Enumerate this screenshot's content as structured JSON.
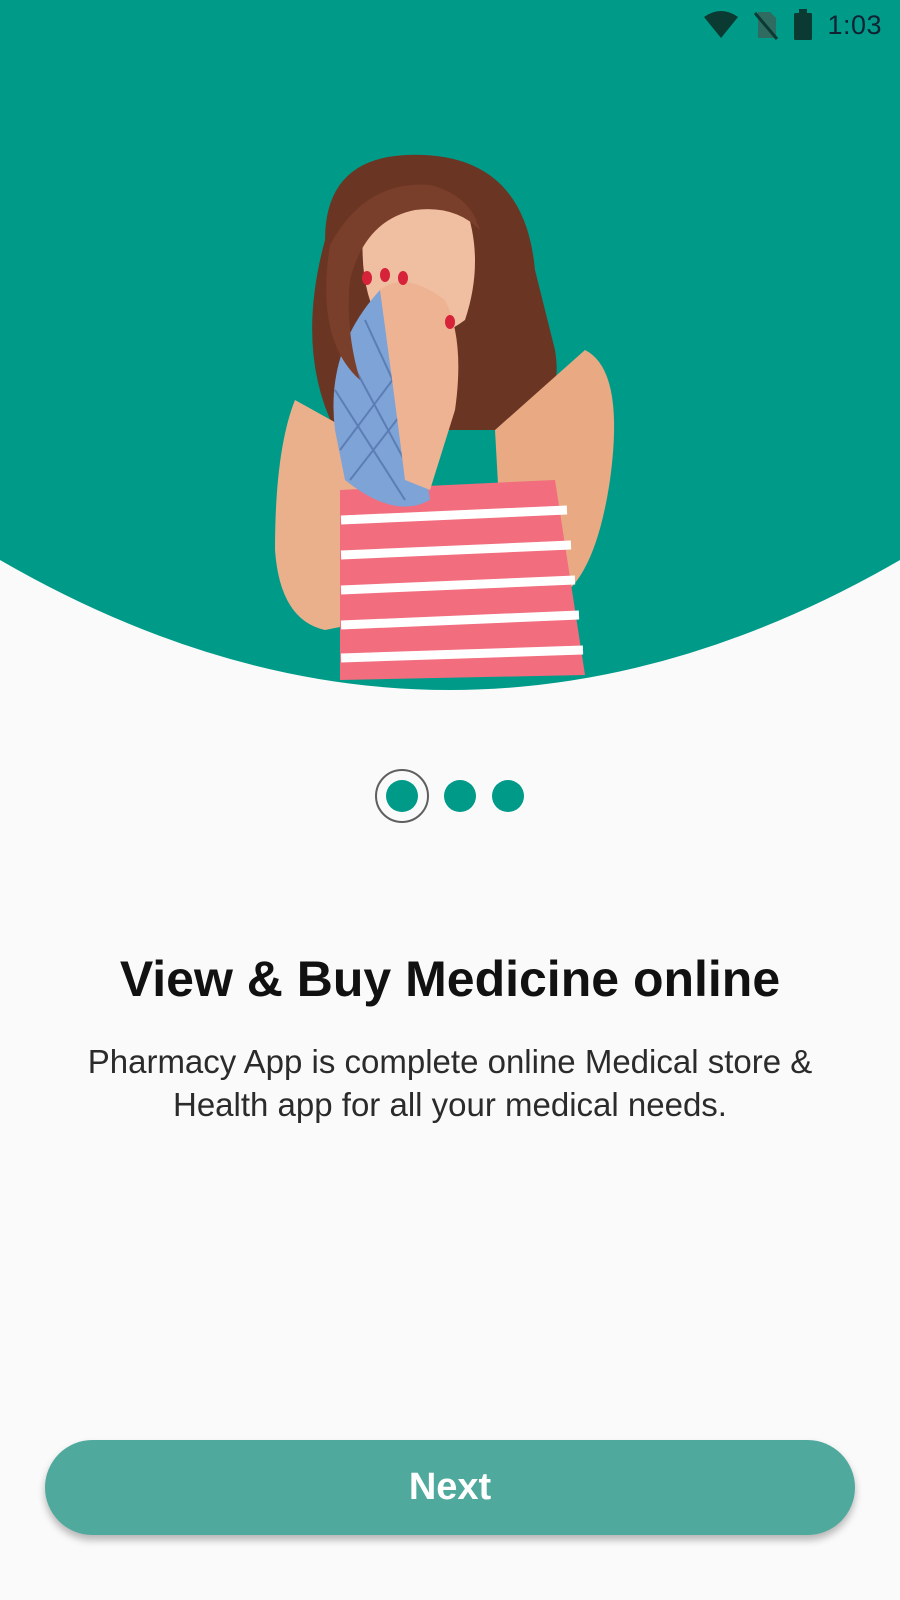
{
  "colors": {
    "brand": "#009b88",
    "button": "#4fa99d",
    "background": "#fafafa"
  },
  "status_bar": {
    "time": "1:03",
    "icons": [
      "wifi-icon",
      "no-sim-icon",
      "battery-icon"
    ]
  },
  "onboarding": {
    "pages_total": 3,
    "current_page": 1,
    "title": "View & Buy Medicine online",
    "description": "Pharmacy App is complete online Medical store & Health app for all your medical needs.",
    "next_label": "Next"
  }
}
